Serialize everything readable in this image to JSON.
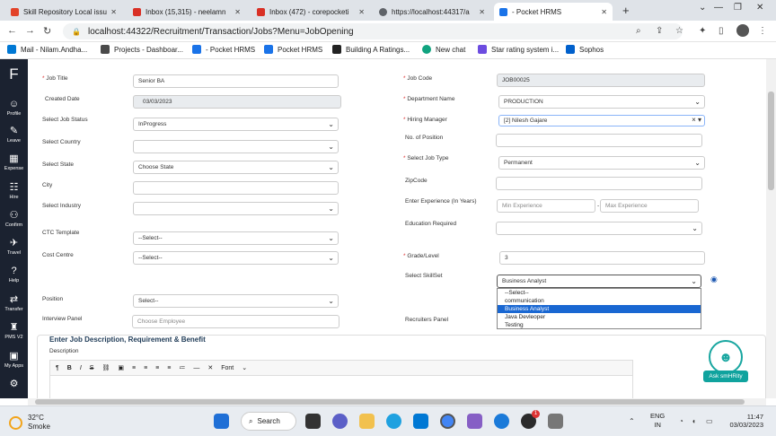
{
  "browser": {
    "tabs": [
      {
        "title": "Skill Repository Local issu",
        "color": "#e24329"
      },
      {
        "title": "Inbox (15,315) - neelamn",
        "color": "#d93025"
      },
      {
        "title": "Inbox (472) - corepocketi",
        "color": "#d93025"
      },
      {
        "title": "https://localhost:44317/a",
        "color": "#5f6368"
      },
      {
        "title": "- Pocket HRMS",
        "color": "#1a73e8"
      }
    ],
    "url": "localhost:44322/Recruitment/Transaction/Jobs?Menu=JobOpening",
    "bookmarks": [
      {
        "label": "Mail - Nilam.Andha...",
        "color": "#0078d4"
      },
      {
        "label": "Projects - Dashboar...",
        "color": "#4a4a4a"
      },
      {
        "label": "- Pocket HRMS",
        "color": "#1a73e8"
      },
      {
        "label": "Pocket HRMS",
        "color": "#1a73e8"
      },
      {
        "label": "Building A Ratings...",
        "color": "#222"
      },
      {
        "label": "New chat",
        "color": "#10a37f"
      },
      {
        "label": "Star rating system i...",
        "color": "#6c4ce0"
      },
      {
        "label": "Sophos",
        "color": "#0060cc"
      }
    ]
  },
  "sidebar": {
    "items": [
      {
        "label": "Profile",
        "glyph": "☺"
      },
      {
        "label": "Leave",
        "glyph": "✎"
      },
      {
        "label": "Expense",
        "glyph": "▦"
      },
      {
        "label": "Hire",
        "glyph": "☷"
      },
      {
        "label": "Confirm",
        "glyph": "⚇"
      },
      {
        "label": "Travel",
        "glyph": "✈"
      },
      {
        "label": "Help",
        "glyph": "?"
      },
      {
        "label": "Transfer",
        "glyph": "⇄"
      },
      {
        "label": "PMS V2",
        "glyph": "♜"
      },
      {
        "label": "My Apps",
        "glyph": "▣"
      },
      {
        "label": "",
        "glyph": "⚙"
      }
    ]
  },
  "form": {
    "left": {
      "job_title_label": "Job Title",
      "job_title": "Senior BA",
      "created_date_label": "Created Date",
      "created_date": "03/03/2023",
      "job_status_label": "Select Job Status",
      "job_status": "InProgress",
      "country_label": "Select Country",
      "country": "",
      "state_label": "Select State",
      "state": "Choose State",
      "city_label": "City",
      "city": "",
      "industry_label": "Select Industry",
      "industry": "",
      "ctc_label": "CTC Template",
      "ctc": "--Select--",
      "cost_centre_label": "Cost Centre",
      "cost_centre": "--Select--",
      "position_label": "Position",
      "position": "Select--",
      "interview_panel_label": "Interview Panel",
      "interview_panel_placeholder": "Choose Employee"
    },
    "right": {
      "job_code_label": "Job Code",
      "job_code": "JOB00025",
      "department_label": "Department Name",
      "department": "PRODUCTION",
      "hiring_manager_label": "Hiring Manager",
      "hiring_manager": "[2] Nilesh Gajare",
      "no_position_label": "No. of Position",
      "no_position": "",
      "job_type_label": "Select Job Type",
      "job_type": "Permanent",
      "zip_label": "ZipCode",
      "zip": "",
      "experience_label": "Enter Experience (In Years)",
      "min_exp_placeholder": "Min Experience",
      "max_exp_placeholder": "Max Experience",
      "education_label": "Education Required",
      "education": "",
      "grade_label": "Grade/Level",
      "grade": "3",
      "skillset_label": "Select SkillSet",
      "skillset": "Business Analyst",
      "skillset_options": [
        "--Select--",
        "communication",
        "Business Analyst",
        "Java Devleoper",
        "Testing"
      ],
      "skillset_selected_index": 2,
      "recruiters_label": "Recruiters Panel"
    }
  },
  "jd": {
    "title": "Enter Job Description, Requirement & Benefit",
    "description_label": "Description",
    "toolbar": [
      "¶",
      "B",
      "I",
      "S",
      "⛓",
      "▣",
      "≡",
      "≡",
      "≡",
      "≡",
      "≔",
      "—",
      "✕",
      "Font",
      "⌄"
    ]
  },
  "assistant": {
    "label": "Ask smHRity"
  },
  "taskbar": {
    "temp": "32°C",
    "weather": "Smoke",
    "search": "Search",
    "lang1": "ENG",
    "lang2": "IN",
    "time": "11:47",
    "date": "03/03/2023",
    "badge": "1"
  }
}
